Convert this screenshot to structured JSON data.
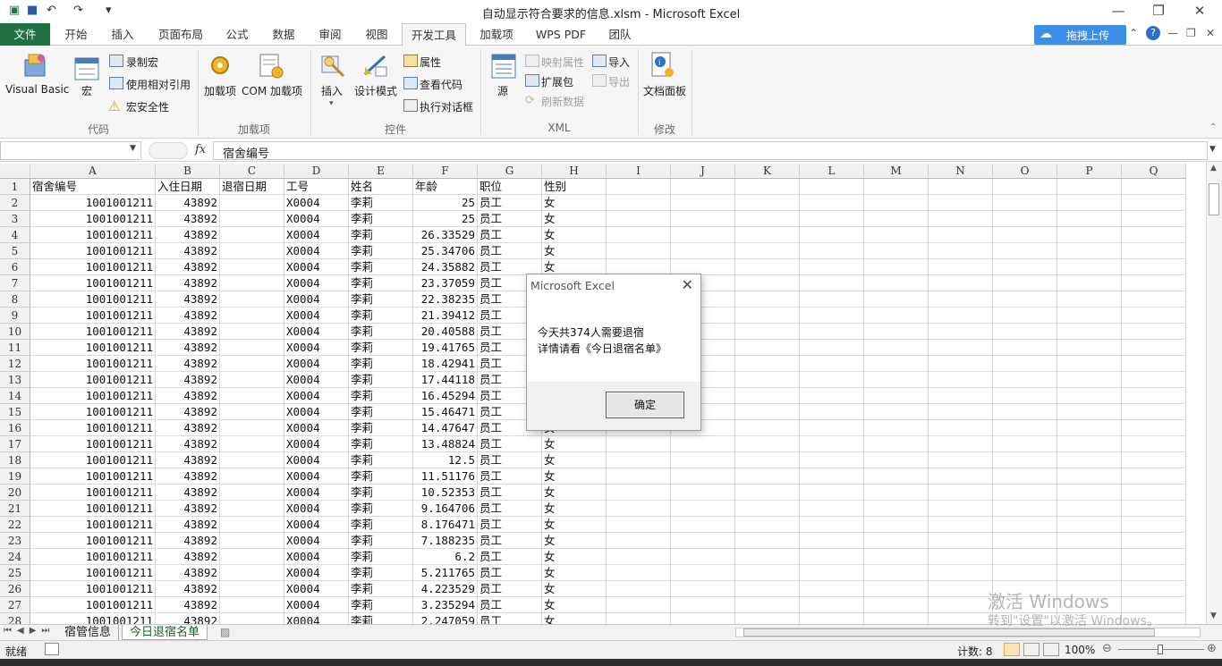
{
  "window": {
    "title": "自动显示符合要求的信息.xlsm  -  Microsoft Excel",
    "controls": {
      "minimize": "—",
      "restore": "❐",
      "close": "✕"
    }
  },
  "quick_access": {
    "save_icon": "save-icon",
    "undo": "↶",
    "redo": "↷",
    "customize": "▾"
  },
  "ribbon_tabs": [
    "文件",
    "开始",
    "插入",
    "页面布局",
    "公式",
    "数据",
    "审阅",
    "视图",
    "开发工具",
    "加载项",
    "WPS PDF",
    "团队"
  ],
  "active_tab": "开发工具",
  "upload_button": "拖拽上传",
  "ribbon": {
    "code": {
      "label": "代码",
      "visual_basic": "Visual Basic",
      "macros": "宏",
      "record_macro": "录制宏",
      "relative_ref": "使用相对引用",
      "macro_security": "宏安全性"
    },
    "addins": {
      "label": "加载项",
      "addins": "加载项",
      "com_addins": "COM 加载项"
    },
    "controls": {
      "label": "控件",
      "insert": "插入",
      "design_mode": "设计模式",
      "properties": "属性",
      "view_code": "查看代码",
      "run_dialog": "执行对话框"
    },
    "xml": {
      "label": "XML",
      "source": "源",
      "map_properties": "映射属性",
      "expansion_packs": "扩展包",
      "refresh_data": "刷新数据",
      "import": "导入",
      "export": "导出"
    },
    "modify": {
      "label": "修改",
      "document_panel": "文档面板"
    }
  },
  "formula_bar": {
    "name_box": "",
    "fx": "fx",
    "content": "宿舍编号"
  },
  "columns": [
    "A",
    "B",
    "C",
    "D",
    "E",
    "F",
    "G",
    "H",
    "I",
    "J",
    "K",
    "L",
    "M",
    "N",
    "O",
    "P",
    "Q"
  ],
  "header_row": [
    "宿舍编号",
    "入住日期",
    "退宿日期",
    "工号",
    "姓名",
    "年龄",
    "职位",
    "性别"
  ],
  "rows": [
    {
      "n": "2",
      "a": "1001001211",
      "b": "43892",
      "c": "",
      "d": "X0004",
      "e": "李莉",
      "f": "25",
      "g": "员工",
      "h": "女"
    },
    {
      "n": "3",
      "a": "1001001211",
      "b": "43892",
      "c": "",
      "d": "X0004",
      "e": "李莉",
      "f": "25",
      "g": "员工",
      "h": "女"
    },
    {
      "n": "4",
      "a": "1001001211",
      "b": "43892",
      "c": "",
      "d": "X0004",
      "e": "李莉",
      "f": "26.33529",
      "g": "员工",
      "h": "女"
    },
    {
      "n": "5",
      "a": "1001001211",
      "b": "43892",
      "c": "",
      "d": "X0004",
      "e": "李莉",
      "f": "25.34706",
      "g": "员工",
      "h": "女"
    },
    {
      "n": "6",
      "a": "1001001211",
      "b": "43892",
      "c": "",
      "d": "X0004",
      "e": "李莉",
      "f": "24.35882",
      "g": "员工",
      "h": "女"
    },
    {
      "n": "7",
      "a": "1001001211",
      "b": "43892",
      "c": "",
      "d": "X0004",
      "e": "李莉",
      "f": "23.37059",
      "g": "员工",
      "h": ""
    },
    {
      "n": "8",
      "a": "1001001211",
      "b": "43892",
      "c": "",
      "d": "X0004",
      "e": "李莉",
      "f": "22.38235",
      "g": "员工",
      "h": ""
    },
    {
      "n": "9",
      "a": "1001001211",
      "b": "43892",
      "c": "",
      "d": "X0004",
      "e": "李莉",
      "f": "21.39412",
      "g": "员工",
      "h": ""
    },
    {
      "n": "10",
      "a": "1001001211",
      "b": "43892",
      "c": "",
      "d": "X0004",
      "e": "李莉",
      "f": "20.40588",
      "g": "员工",
      "h": ""
    },
    {
      "n": "11",
      "a": "1001001211",
      "b": "43892",
      "c": "",
      "d": "X0004",
      "e": "李莉",
      "f": "19.41765",
      "g": "员工",
      "h": ""
    },
    {
      "n": "12",
      "a": "1001001211",
      "b": "43892",
      "c": "",
      "d": "X0004",
      "e": "李莉",
      "f": "18.42941",
      "g": "员工",
      "h": ""
    },
    {
      "n": "13",
      "a": "1001001211",
      "b": "43892",
      "c": "",
      "d": "X0004",
      "e": "李莉",
      "f": "17.44118",
      "g": "员工",
      "h": ""
    },
    {
      "n": "14",
      "a": "1001001211",
      "b": "43892",
      "c": "",
      "d": "X0004",
      "e": "李莉",
      "f": "16.45294",
      "g": "员工",
      "h": ""
    },
    {
      "n": "15",
      "a": "1001001211",
      "b": "43892",
      "c": "",
      "d": "X0004",
      "e": "李莉",
      "f": "15.46471",
      "g": "员工",
      "h": ""
    },
    {
      "n": "16",
      "a": "1001001211",
      "b": "43892",
      "c": "",
      "d": "X0004",
      "e": "李莉",
      "f": "14.47647",
      "g": "员工",
      "h": "女"
    },
    {
      "n": "17",
      "a": "1001001211",
      "b": "43892",
      "c": "",
      "d": "X0004",
      "e": "李莉",
      "f": "13.48824",
      "g": "员工",
      "h": "女"
    },
    {
      "n": "18",
      "a": "1001001211",
      "b": "43892",
      "c": "",
      "d": "X0004",
      "e": "李莉",
      "f": "12.5",
      "g": "员工",
      "h": "女"
    },
    {
      "n": "19",
      "a": "1001001211",
      "b": "43892",
      "c": "",
      "d": "X0004",
      "e": "李莉",
      "f": "11.51176",
      "g": "员工",
      "h": "女"
    },
    {
      "n": "20",
      "a": "1001001211",
      "b": "43892",
      "c": "",
      "d": "X0004",
      "e": "李莉",
      "f": "10.52353",
      "g": "员工",
      "h": "女"
    },
    {
      "n": "21",
      "a": "1001001211",
      "b": "43892",
      "c": "",
      "d": "X0004",
      "e": "李莉",
      "f": "9.164706",
      "g": "员工",
      "h": "女"
    },
    {
      "n": "22",
      "a": "1001001211",
      "b": "43892",
      "c": "",
      "d": "X0004",
      "e": "李莉",
      "f": "8.176471",
      "g": "员工",
      "h": "女"
    },
    {
      "n": "23",
      "a": "1001001211",
      "b": "43892",
      "c": "",
      "d": "X0004",
      "e": "李莉",
      "f": "7.188235",
      "g": "员工",
      "h": "女"
    },
    {
      "n": "24",
      "a": "1001001211",
      "b": "43892",
      "c": "",
      "d": "X0004",
      "e": "李莉",
      "f": "6.2",
      "g": "员工",
      "h": "女"
    },
    {
      "n": "25",
      "a": "1001001211",
      "b": "43892",
      "c": "",
      "d": "X0004",
      "e": "李莉",
      "f": "5.211765",
      "g": "员工",
      "h": "女"
    },
    {
      "n": "26",
      "a": "1001001211",
      "b": "43892",
      "c": "",
      "d": "X0004",
      "e": "李莉",
      "f": "4.223529",
      "g": "员工",
      "h": "女"
    },
    {
      "n": "27",
      "a": "1001001211",
      "b": "43892",
      "c": "",
      "d": "X0004",
      "e": "李莉",
      "f": "3.235294",
      "g": "员工",
      "h": "女"
    },
    {
      "n": "28",
      "a": "1001001211",
      "b": "43892",
      "c": "",
      "d": "X0004",
      "e": "李莉",
      "f": "2.247059",
      "g": "员工",
      "h": "女"
    }
  ],
  "dialog": {
    "title": "Microsoft Excel",
    "line1": "今天共374人需要退宿",
    "line2": "详情请看《今日退宿名单》",
    "ok": "确定"
  },
  "sheets": [
    "宿管信息",
    "今日退宿名单"
  ],
  "active_sheet": "今日退宿名单",
  "status": {
    "ready": "就绪",
    "count": "计数: 8",
    "zoom": "100%"
  },
  "watermark": {
    "line1": "激活 Windows",
    "line2": "转到\"设置\"以激活 Windows。"
  },
  "colors": {
    "file_tab": "#1f7145",
    "upload": "#3d8ee6",
    "header_bg": "#f0f0f0"
  }
}
